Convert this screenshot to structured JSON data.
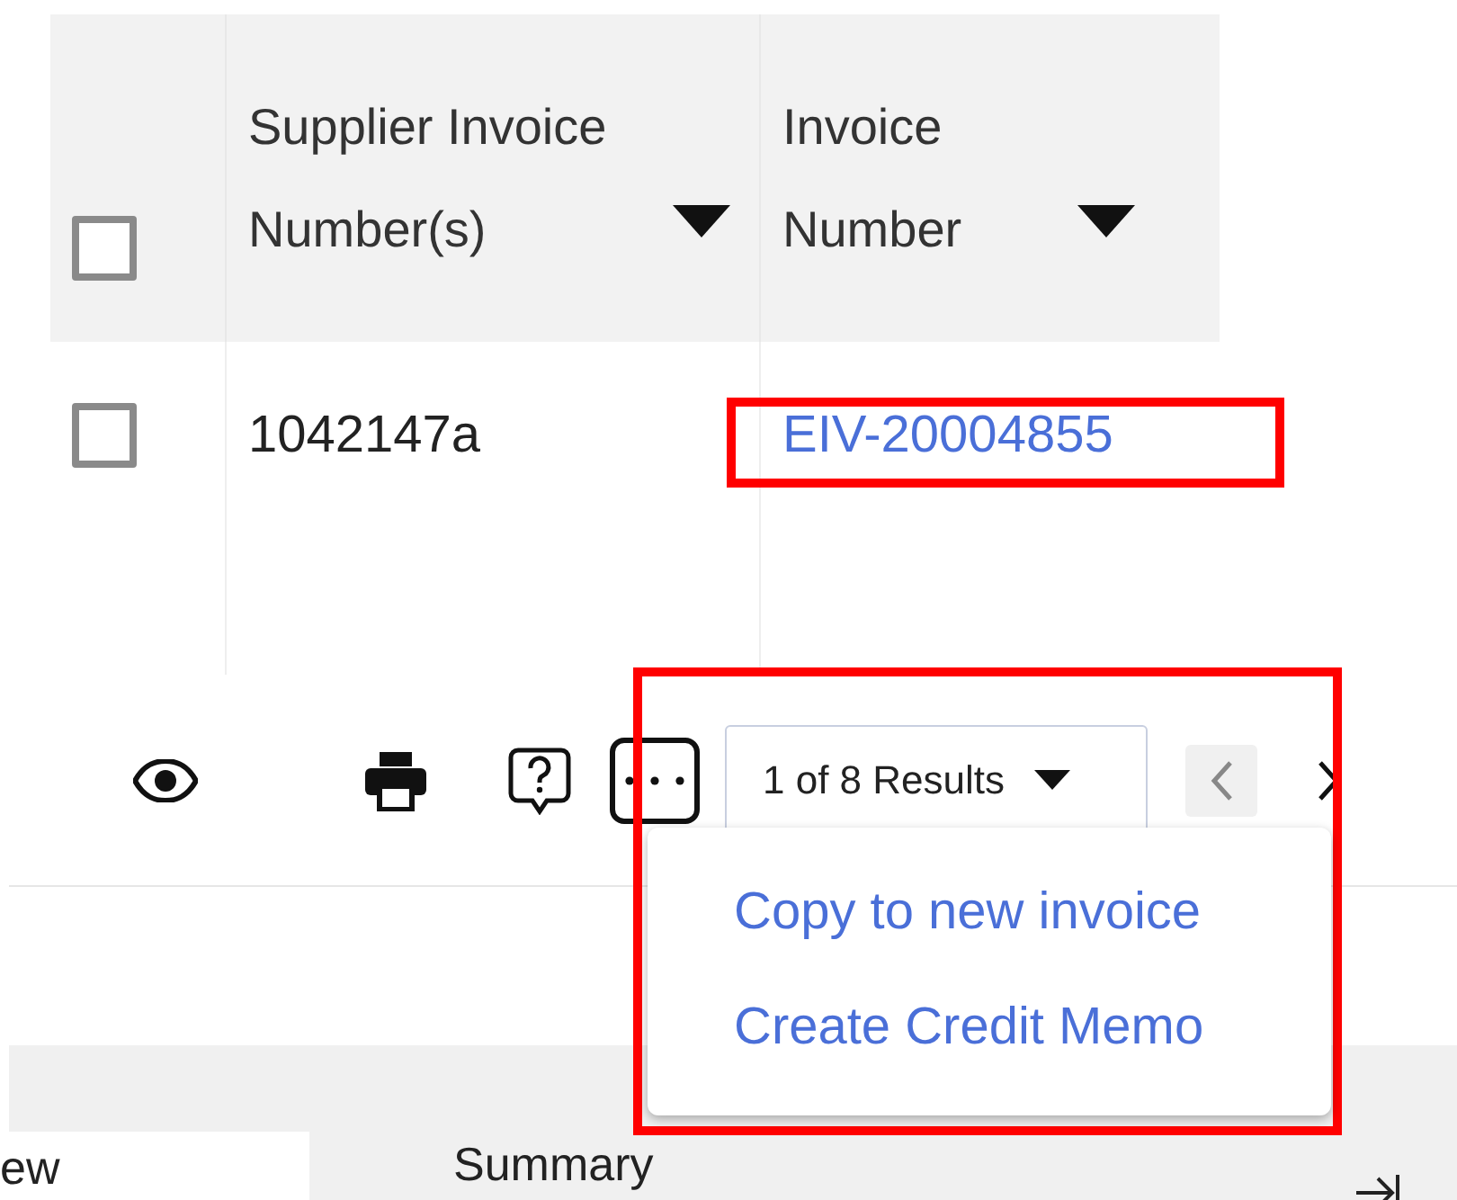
{
  "table": {
    "select_all": {
      "checked": false
    },
    "columns": [
      "Supplier Invoice Number(s)",
      "Invoice Number"
    ],
    "rows": [
      {
        "checked": false,
        "supplier_invoice_number": "1042147a",
        "invoice_number": "EIV-20004855"
      }
    ]
  },
  "toolbar": {
    "results": "1 of 8 Results",
    "prev_disabled": true
  },
  "menu": {
    "open": true,
    "items": [
      "Copy to new invoice",
      "Create Credit Memo"
    ]
  },
  "bottom_tabs": [
    {
      "label": "ew",
      "selected": true
    },
    {
      "label": "Summary",
      "selected": false
    }
  ]
}
